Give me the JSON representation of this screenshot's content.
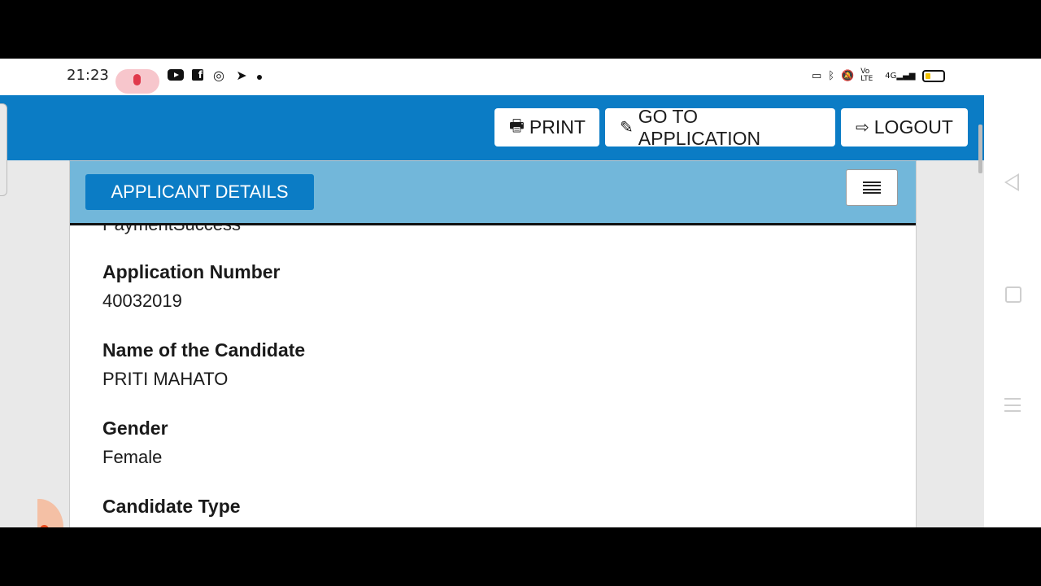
{
  "status_bar": {
    "time": "21:23",
    "left_icons": [
      "mic-icon",
      "youtube-icon",
      "facebook-icon",
      "target-icon",
      "telegram-icon",
      "dot-icon"
    ],
    "right_icons": [
      "screen-icon",
      "bluetooth-icon",
      "mute-icon",
      "volte-icon",
      "signal-4g-icon",
      "battery-icon"
    ],
    "volte_text": "Vo LTE",
    "network_text": "4G"
  },
  "toolbar": {
    "print_label": "PRINT",
    "goto_label": "GO TO APPLICATION",
    "logout_label": "LOGOUT"
  },
  "card": {
    "header_button": "APPLICANT DETAILS",
    "partial_text": "PaymentSuccess",
    "fields": [
      {
        "label": "Application Number",
        "value": "40032019"
      },
      {
        "label": "Name of the Candidate",
        "value": "PRITI MAHATO"
      },
      {
        "label": "Gender",
        "value": "Female"
      },
      {
        "label": "Candidate Type",
        "value": ""
      }
    ]
  },
  "colors": {
    "topbar": "#0b7cc5",
    "card_header": "#72b7da",
    "button_blue": "#0b7cc5"
  }
}
